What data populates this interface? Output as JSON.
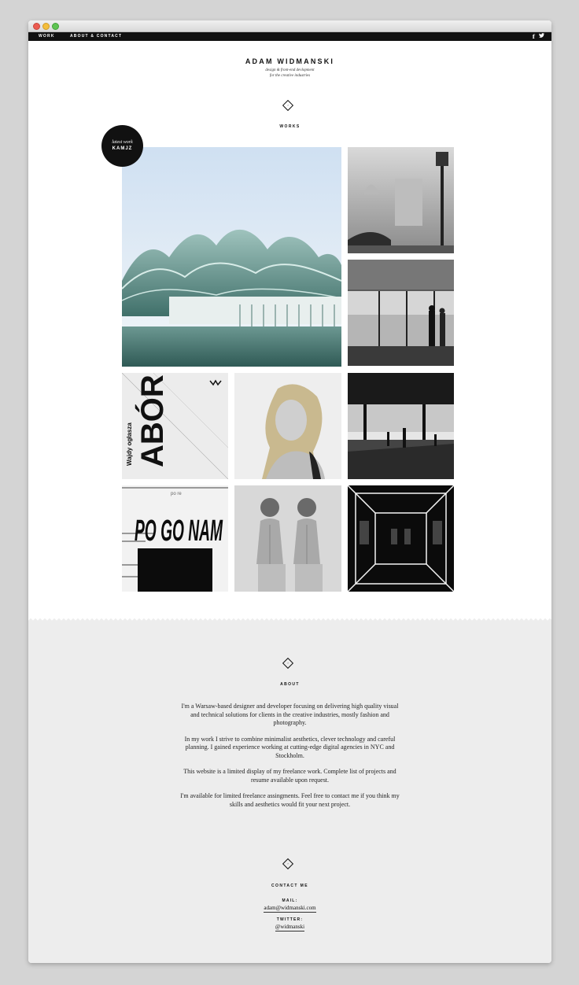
{
  "nav": {
    "work": "WORK",
    "about_contact": "ABOUT & CONTACT",
    "facebook_icon": "f",
    "twitter_icon": "twitter-bird"
  },
  "header": {
    "name": "ADAM WIDMANSKI",
    "subtitle_line1": "design & front-end devlopment",
    "subtitle_line2": "for the creative industries"
  },
  "works": {
    "title": "WORKS",
    "badge_line1": "latest work",
    "badge_line2": "KAMJZ",
    "poster_text": "ABÓR 012",
    "poster_subtext": "Wajdy ogłasza",
    "pogo_text": "PO GO NAM",
    "pogo_side": "po re"
  },
  "about": {
    "title": "ABOUT",
    "paragraphs": [
      "I'm a Warsaw-based designer and developer focusing on delivering high quality visual and technical solutions for clients in the creative industries, mostly fashion and photography.",
      "In my work I strive to combine minimalist aesthetics, clever technology and careful planning. I gained experience working at cutting-edge digital agencies in NYC and Stockholm.",
      "This website is a limited display of my freelance work. Complete list of projects and resume available upon request.",
      "I'm available for limited freelance assingments. Feel free to contact me if you think my skills and aesthetics would fit your next project."
    ]
  },
  "contact": {
    "title": "CONTACT ME",
    "mail_label": "MAIL:",
    "mail_value": "adam@widmanski.com",
    "twitter_label": "TWITTER:",
    "twitter_value": "@widmanski"
  },
  "colors": {
    "accent": "#111111",
    "about_bg": "#ededed"
  }
}
